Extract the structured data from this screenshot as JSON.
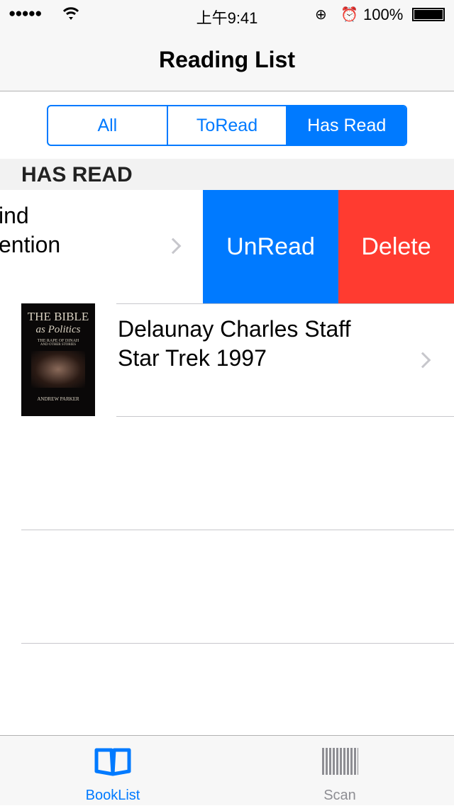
{
  "status": {
    "time": "上午9:41",
    "battery": "100%"
  },
  "nav": {
    "title": "Reading List"
  },
  "segments": {
    "items": [
      "All",
      "ToRead",
      "Has Read"
    ],
    "selected": "Has Read"
  },
  "section": {
    "header": "HAS READ"
  },
  "rows": [
    {
      "line1": "ind",
      "line2": "ention",
      "actions": {
        "unread": "UnRead",
        "delete": "Delete"
      }
    },
    {
      "line1": "Delaunay Charles Staff",
      "line2": "Star Trek 1997",
      "cover": {
        "title": "THE BIBLE",
        "subtitle": "as Politics",
        "tagline1": "THE RAPE OF DINAH",
        "tagline2": "AND OTHER STORIES",
        "author": "ANDREW PARKER"
      }
    }
  ],
  "tabs": [
    {
      "label": "BookList",
      "icon": "book-icon",
      "active": true
    },
    {
      "label": "Scan",
      "icon": "barcode-icon",
      "active": false
    }
  ],
  "colors": {
    "accent": "#007aff",
    "delete": "#ff3b30"
  }
}
